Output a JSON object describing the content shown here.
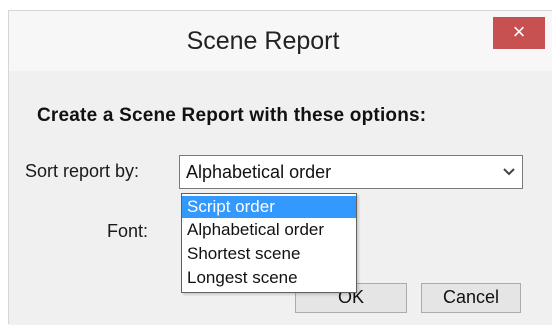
{
  "dialog": {
    "title": "Scene Report",
    "close_glyph": "×",
    "heading": "Create a Scene Report with these options:",
    "sort_label": "Sort report by:",
    "sort_selected": "Alphabetical order",
    "sort_options": [
      "Script order",
      "Alphabetical order",
      "Shortest scene",
      "Longest scene"
    ],
    "highlighted_option": "Script order",
    "font_label": "Font:",
    "ok_label": "OK",
    "cancel_label": "Cancel"
  },
  "colors": {
    "close_button": "#c75050",
    "highlight": "#3399ff",
    "dialog_background": "#f0f0f0"
  },
  "icons": {
    "close": "close-icon",
    "dropdown_arrow": "chevron-down-icon"
  }
}
